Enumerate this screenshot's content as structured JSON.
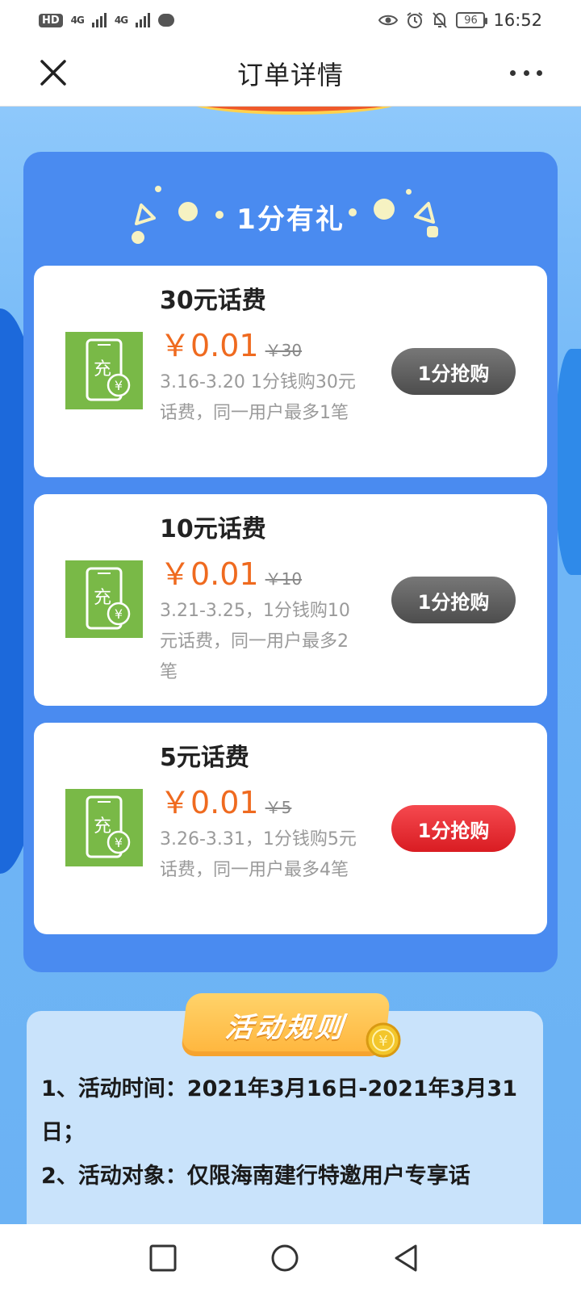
{
  "status_bar": {
    "left_badge": "HD",
    "signal1": "4G",
    "signal2": "4G",
    "battery": "96",
    "time": "16:52",
    "icons": [
      "hd-icon",
      "signal-icon",
      "signal-icon",
      "message-icon",
      "eye-icon",
      "alarm-icon",
      "mute-icon",
      "battery-icon"
    ]
  },
  "nav": {
    "title": "订单详情",
    "close_icon": "close-icon",
    "more_icon": "more-icon"
  },
  "promo": {
    "title": "1分有礼",
    "offers": [
      {
        "name": "30元话费",
        "price": "￥0.01",
        "original": "￥30",
        "desc": "3.16-3.20 1分钱购30元话费，同一用户最多1笔",
        "button": "1分抢购",
        "button_state": "disabled",
        "icon": "phone-recharge-icon",
        "icon_char": "充"
      },
      {
        "name": "10元话费",
        "price": "￥0.01",
        "original": "￥10",
        "desc": "3.21-3.25，1分钱购10元话费，同一用户最多2笔",
        "button": "1分抢购",
        "button_state": "disabled",
        "icon": "phone-recharge-icon",
        "icon_char": "充"
      },
      {
        "name": "5元话费",
        "price": "￥0.01",
        "original": "￥5",
        "desc": "3.26-3.31，1分钱购5元话费，同一用户最多4笔",
        "button": "1分抢购",
        "button_state": "active",
        "icon": "phone-recharge-icon",
        "icon_char": "充"
      }
    ]
  },
  "rules": {
    "badge": "活动规则",
    "line1": "1、活动时间：2021年3月16日-2021年3月31日；",
    "line2": "2、活动对象：仅限海南建行特邀用户专享话"
  },
  "colors": {
    "price": "#ef6a1f",
    "panel": "#4a8bf0",
    "button_disabled": "#5a5a5a",
    "button_active": "#e8262c",
    "background": "#6fb5f6"
  }
}
